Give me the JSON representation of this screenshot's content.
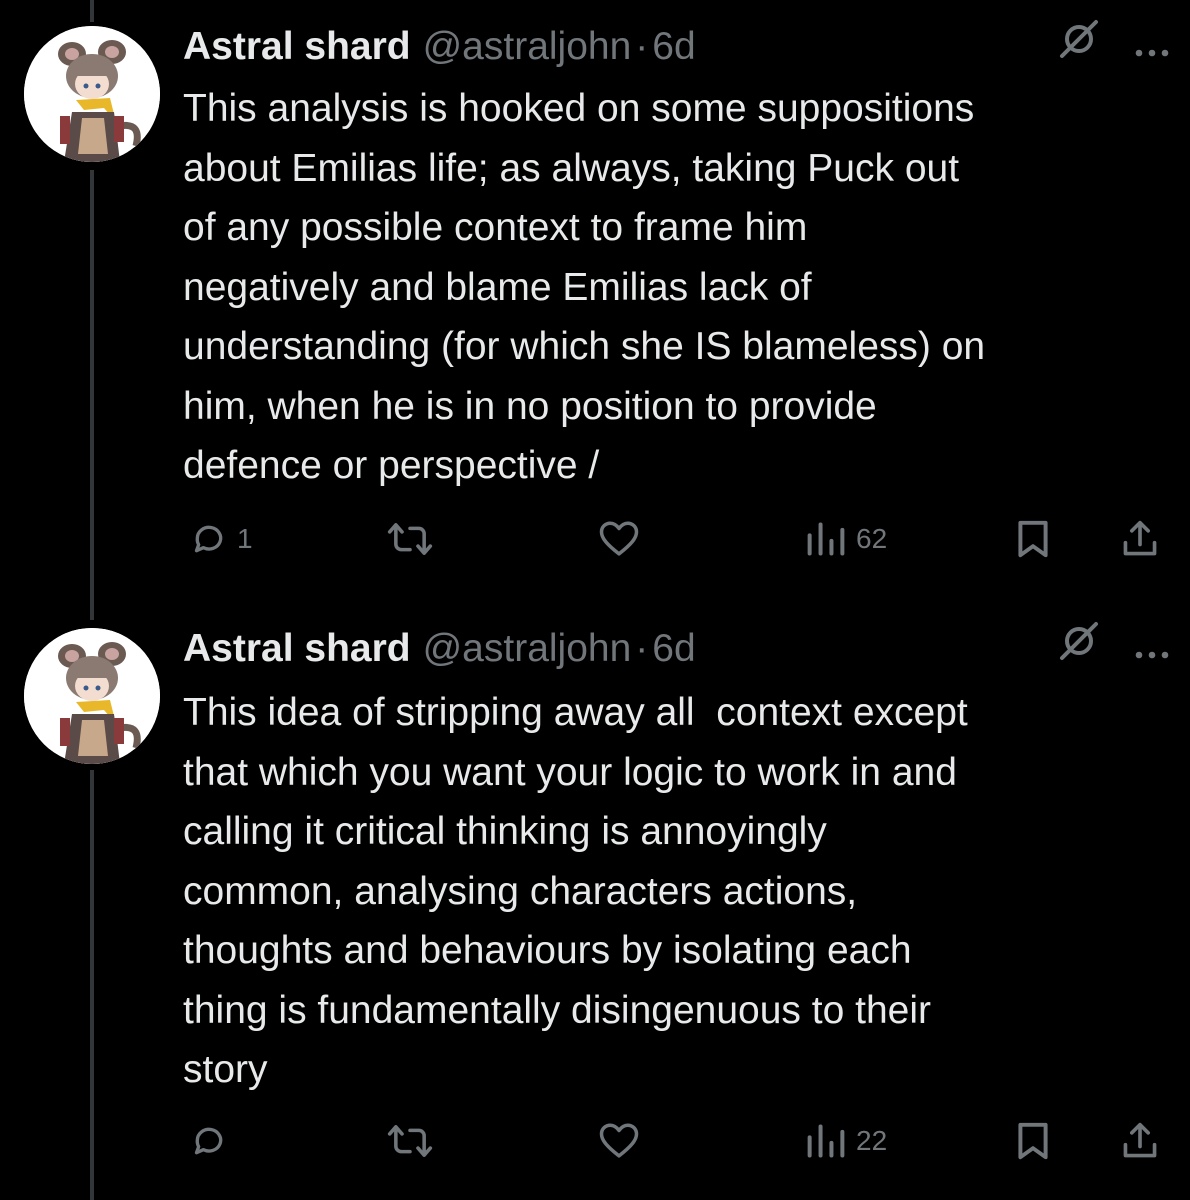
{
  "tweets": [
    {
      "author": {
        "display_name": "Astral shard",
        "handle": "@astraljohn",
        "separator": "·",
        "time": "6d",
        "avatar": "anime-character-avatar"
      },
      "text": "This analysis is hooked on some suppositions\nabout Emilias life; as always, taking Puck out\nof any possible context to frame him\nnegatively and blame Emilias lack of\nunderstanding (for which she IS blameless) on\nhim, when he is in no position to provide\ndefence or perspective /",
      "actions": {
        "reply_count": "1",
        "retweet_count": "",
        "like_count": "",
        "views_count": "62"
      }
    },
    {
      "author": {
        "display_name": "Astral shard",
        "handle": "@astraljohn",
        "separator": "·",
        "time": "6d",
        "avatar": "anime-character-avatar"
      },
      "text": "This idea of stripping away all  context except\nthat which you want your logic to work in and\ncalling it critical thinking is annoyingly\ncommon, analysing characters actions,\nthoughts and behaviours by isolating each\nthing is fundamentally disingenuous to their\nstory",
      "actions": {
        "reply_count": "",
        "retweet_count": "",
        "like_count": "",
        "views_count": "22"
      }
    }
  ],
  "icons": {
    "reply": "reply-icon",
    "retweet": "retweet-icon",
    "like": "heart-icon",
    "views": "views-icon",
    "bookmark": "bookmark-icon",
    "share": "share-icon",
    "grok": "grok-icon",
    "more": "more-icon"
  },
  "colors": {
    "background": "#000000",
    "text": "#e7e9ea",
    "secondary": "#71767b",
    "thread_line": "#333639"
  }
}
